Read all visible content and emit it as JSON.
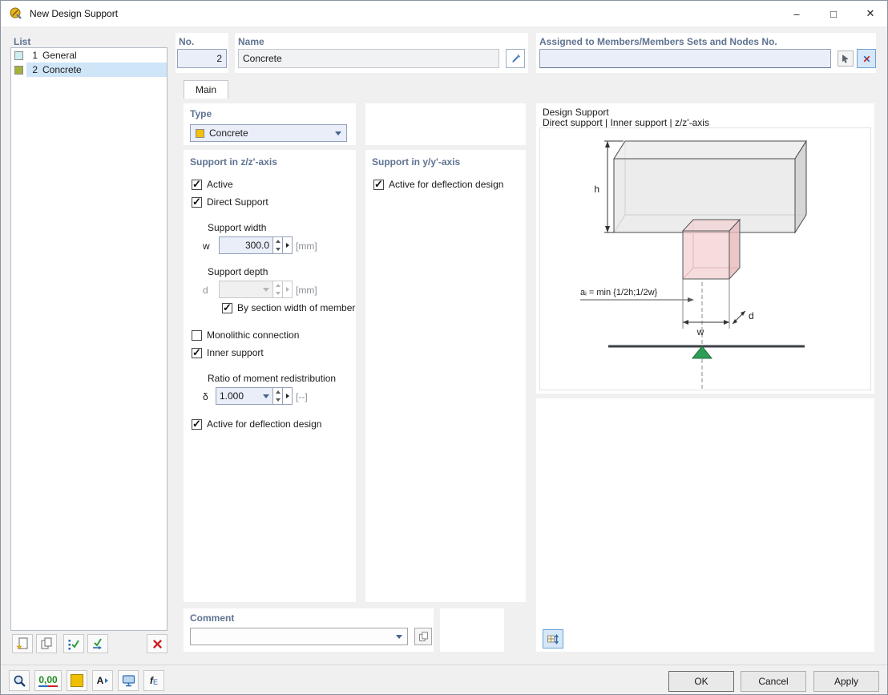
{
  "window": {
    "title": "New Design Support"
  },
  "glyphs": {
    "minimize": "–",
    "maximize": "□",
    "close": "✕",
    "units": "0,00",
    "a": "A",
    "fx_f": "f",
    "fx_sub": "E"
  },
  "list": {
    "title": "List",
    "items": [
      {
        "num": "1",
        "label": "General",
        "color": "#cdeef0"
      },
      {
        "num": "2",
        "label": "Concrete",
        "color": "#a2b23a"
      }
    ]
  },
  "header": {
    "no_label": "No.",
    "no_value": "2",
    "name_label": "Name",
    "name_value": "Concrete",
    "assigned_label": "Assigned to Members/Members Sets and Nodes No.",
    "assigned_value": ""
  },
  "tab": {
    "main": "Main"
  },
  "type": {
    "label": "Type",
    "value": "Concrete",
    "swatch": "#f5be0b"
  },
  "zz": {
    "title": "Support in z/z'-axis",
    "active": "Active",
    "direct": "Direct Support",
    "width_label": "Support width",
    "w": "w",
    "w_value": "300.0",
    "mm": "[mm]",
    "depth_label": "Support depth",
    "d": "d",
    "d_value": "",
    "by_section": "By section width of member",
    "monolithic": "Monolithic connection",
    "inner": "Inner support",
    "ratio": "Ratio of moment redistribution",
    "delta": "δ",
    "delta_value": "1.000",
    "unitless": "[--]",
    "deflection": "Active for deflection design"
  },
  "yy": {
    "title": "Support in y/y'-axis",
    "deflection": "Active for deflection design"
  },
  "preview": {
    "title": "Design Support",
    "subtitle": "Direct support | Inner support | z/z'-axis",
    "h": "h",
    "ai": "aᵢ = min {1/2h;1/2w}",
    "w": "w",
    "d": "d"
  },
  "comment": {
    "label": "Comment",
    "value": ""
  },
  "footer": {
    "ok": "OK",
    "cancel": "Cancel",
    "apply": "Apply"
  },
  "colors": {
    "accent": "#2c6cb5",
    "header_text": "#5f7391",
    "selection": "#cfe5f8",
    "input_bg": "#e9eef9",
    "toolbar_swatch": "#f0c000"
  }
}
